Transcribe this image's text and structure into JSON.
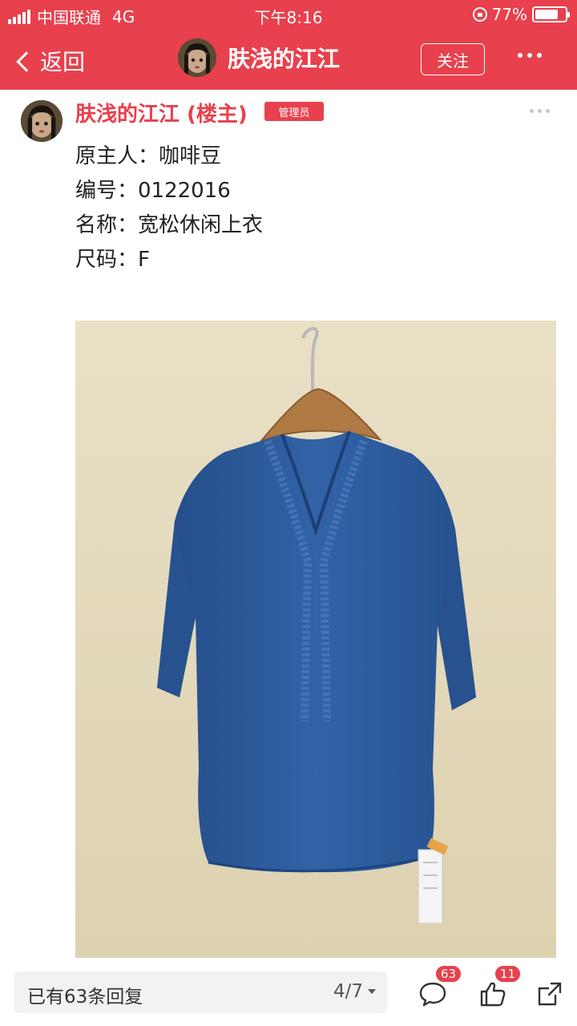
{
  "status_bar": {
    "carrier": "中国联通",
    "network": "4G",
    "time": "下午8:16",
    "battery_text": "77%",
    "battery_level": 0.77
  },
  "nav": {
    "back_label": "返回",
    "title": "肤浅的江江",
    "follow_label": "关注"
  },
  "post": {
    "author": "肤浅的江江 (楼主)",
    "badge": "管理员",
    "lines": [
      "原主人：咖啡豆",
      "编号：0122016",
      "名称：宽松休闲上衣",
      "尺码：F"
    ]
  },
  "bottom_bar": {
    "reply_text": "已有63条回复",
    "page_indicator": "4/7",
    "comment_count": "63",
    "like_count": "11"
  },
  "colors": {
    "accent": "#e8404d",
    "photo_background": "#e6dcbf",
    "shirt": "#2e5a9c"
  }
}
